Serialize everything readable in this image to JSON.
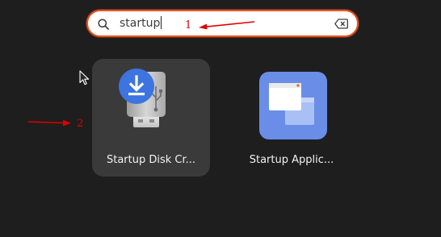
{
  "search": {
    "query": "startup"
  },
  "annotations": [
    {
      "label": "1"
    },
    {
      "label": "2"
    }
  ],
  "apps": [
    {
      "name": "Startup Disk Cr...",
      "icon": "usb-drive-download-icon",
      "selected": true
    },
    {
      "name": "Startup Applic...",
      "icon": "startup-applications-icon",
      "selected": false
    }
  ],
  "colors": {
    "background": "#1e1e1e",
    "search_border": "#e95420",
    "annotation": "#e00000",
    "selected_tile": "#3a3a3a",
    "download_badge": "#3d74e0"
  }
}
